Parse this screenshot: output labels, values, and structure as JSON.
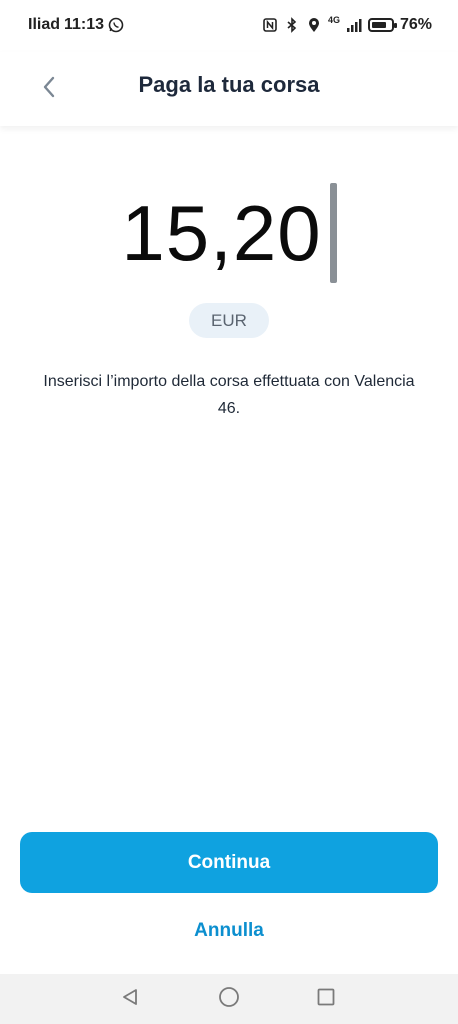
{
  "status_bar": {
    "carrier": "Iliad",
    "time": "11:13",
    "network": "4G",
    "battery_percent": "76%",
    "battery_level": 0.76,
    "icons": [
      "whatsapp-icon",
      "nfc-icon",
      "bluetooth-icon",
      "location-icon",
      "signal-icon",
      "battery-icon"
    ]
  },
  "header": {
    "title": "Paga la tua corsa",
    "back_icon": "chevron-left-icon"
  },
  "amount": {
    "value": "15,20",
    "currency": "EUR"
  },
  "description": "Inserisci l’importo della corsa effettuata con Valencia 46.",
  "actions": {
    "primary_label": "Continua",
    "secondary_label": "Annulla"
  },
  "nav_bar": {
    "icons": [
      "back-triangle-icon",
      "home-circle-icon",
      "recents-square-icon"
    ]
  },
  "colors": {
    "primary": "#0fa2e0",
    "link": "#0c8fcf",
    "currency_bg": "#e9f1f8",
    "title": "#1e293b"
  }
}
